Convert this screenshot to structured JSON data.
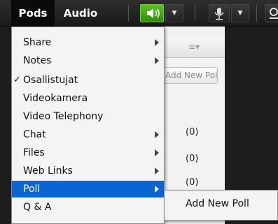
{
  "menubar": {
    "menus": [
      {
        "label": "Pods",
        "active": true
      },
      {
        "label": "Audio",
        "active": false
      }
    ],
    "icons": [
      "speaker-icon",
      "chevron-down-icon",
      "microphone-icon",
      "chevron-down-icon",
      "webcam-icon"
    ],
    "accent_green": "#4caf1a"
  },
  "pod": {
    "add_poll_label": "Add New Poll",
    "counts": [
      "(0)",
      "(0)",
      "(0)"
    ]
  },
  "dropdown": {
    "items": [
      {
        "label": "Share",
        "submenu": true,
        "checked": false
      },
      {
        "label": "Notes",
        "submenu": true,
        "checked": false
      },
      {
        "label": "Osallistujat",
        "submenu": false,
        "checked": true
      },
      {
        "label": "Videokamera",
        "submenu": false,
        "checked": false
      },
      {
        "label": "Video Telephony",
        "submenu": false,
        "checked": false
      },
      {
        "label": "Chat",
        "submenu": true,
        "checked": false
      },
      {
        "label": "Files",
        "submenu": true,
        "checked": false
      },
      {
        "label": "Web Links",
        "submenu": true,
        "checked": false
      },
      {
        "label": "Poll",
        "submenu": true,
        "checked": false,
        "selected": true
      },
      {
        "label": "Q & A",
        "submenu": false,
        "checked": false
      }
    ],
    "check_glyph": "✓",
    "selection_color": "#0a64d2"
  },
  "submenu": {
    "items": [
      {
        "label": "Add New Poll"
      }
    ]
  }
}
